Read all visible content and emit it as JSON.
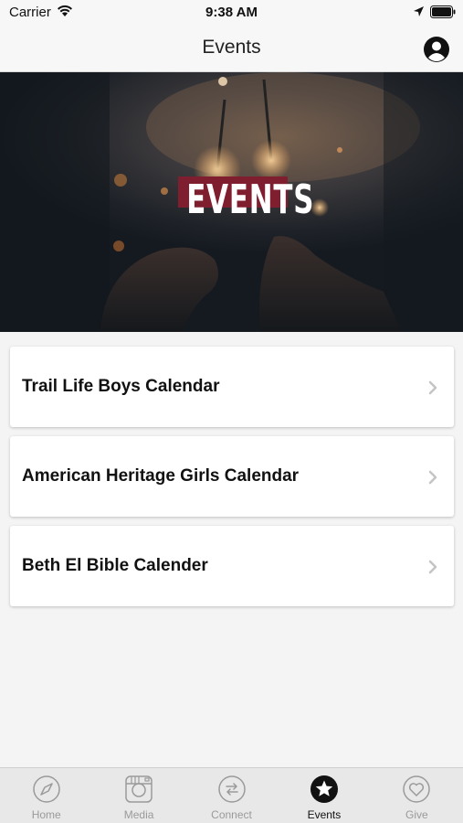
{
  "status_bar": {
    "carrier": "Carrier",
    "time": "9:38 AM"
  },
  "nav": {
    "title": "Events",
    "profile_icon": "person-circle-icon"
  },
  "hero": {
    "banner_text": "EVENTS",
    "banner_color": "#7e1e2e"
  },
  "list": {
    "items": [
      {
        "label": "Trail Life Boys Calendar"
      },
      {
        "label": "American Heritage Girls Calendar"
      },
      {
        "label": "Beth El Bible Calender"
      }
    ]
  },
  "tabs": [
    {
      "label": "Home",
      "icon": "compass-icon",
      "active": false
    },
    {
      "label": "Media",
      "icon": "camera-icon",
      "active": false
    },
    {
      "label": "Connect",
      "icon": "arrows-exchange-icon",
      "active": false
    },
    {
      "label": "Events",
      "icon": "star-circle-icon",
      "active": true
    },
    {
      "label": "Give",
      "icon": "heart-icon",
      "active": false
    }
  ]
}
